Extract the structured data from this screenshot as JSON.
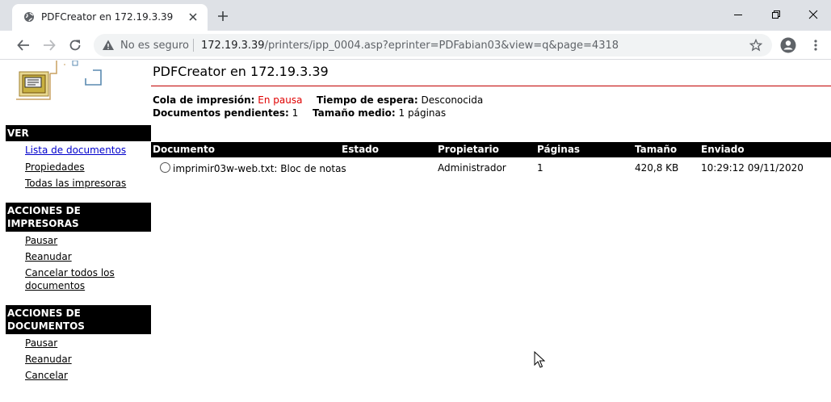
{
  "browser": {
    "tab_title": "PDFCreator en 172.19.3.39",
    "security_label": "No es seguro",
    "url_host": "172.19.3.39",
    "url_path": "/printers/ipp_0004.asp?eprinter=PDFabian03&view=q&page=4318"
  },
  "page": {
    "title": "PDFCreator en 172.19.3.39",
    "queue_label": "Cola de impresión:",
    "queue_status": "En pausa",
    "wait_label": "Tiempo de espera:",
    "wait_value": "Desconocida",
    "pending_label": "Documentos pendientes:",
    "pending_value": "1",
    "avg_size_label": "Tamaño medio:",
    "avg_size_value": "1 páginas"
  },
  "sidebar": {
    "view_header": "VER",
    "view_items": [
      "Lista de documentos",
      "Propiedades",
      "Todas las impresoras"
    ],
    "printer_actions_header_1": "ACCIONES DE",
    "printer_actions_header_2": "IMPRESORAS",
    "printer_actions": [
      "Pausar",
      "Reanudar",
      "Cancelar todos los",
      "documentos"
    ],
    "doc_actions_header_1": "ACCIONES DE",
    "doc_actions_header_2": "DOCUMENTOS",
    "doc_actions": [
      "Pausar",
      "Reanudar",
      "Cancelar"
    ]
  },
  "table": {
    "columns": [
      "Documento",
      "Estado",
      "Propietario",
      "Páginas",
      "Tamaño",
      "Enviado"
    ],
    "rows": [
      {
        "document": "imprimir03w-web.txt: Bloc de notas",
        "status": "",
        "owner": "Administrador",
        "pages": "1",
        "size": "420,8 KB",
        "sent": "10:29:12 09/11/2020"
      }
    ]
  },
  "colors": {
    "status_paused": "#e00000",
    "title_rule": "#c00000",
    "header_bg": "#000000"
  },
  "icons": [
    "globe-icon",
    "close-icon",
    "plus-icon",
    "minimize-icon",
    "restore-icon",
    "back-icon",
    "forward-icon",
    "reload-icon",
    "warning-icon",
    "star-icon",
    "profile-icon",
    "menu-icon",
    "printer-logo-icon"
  ]
}
